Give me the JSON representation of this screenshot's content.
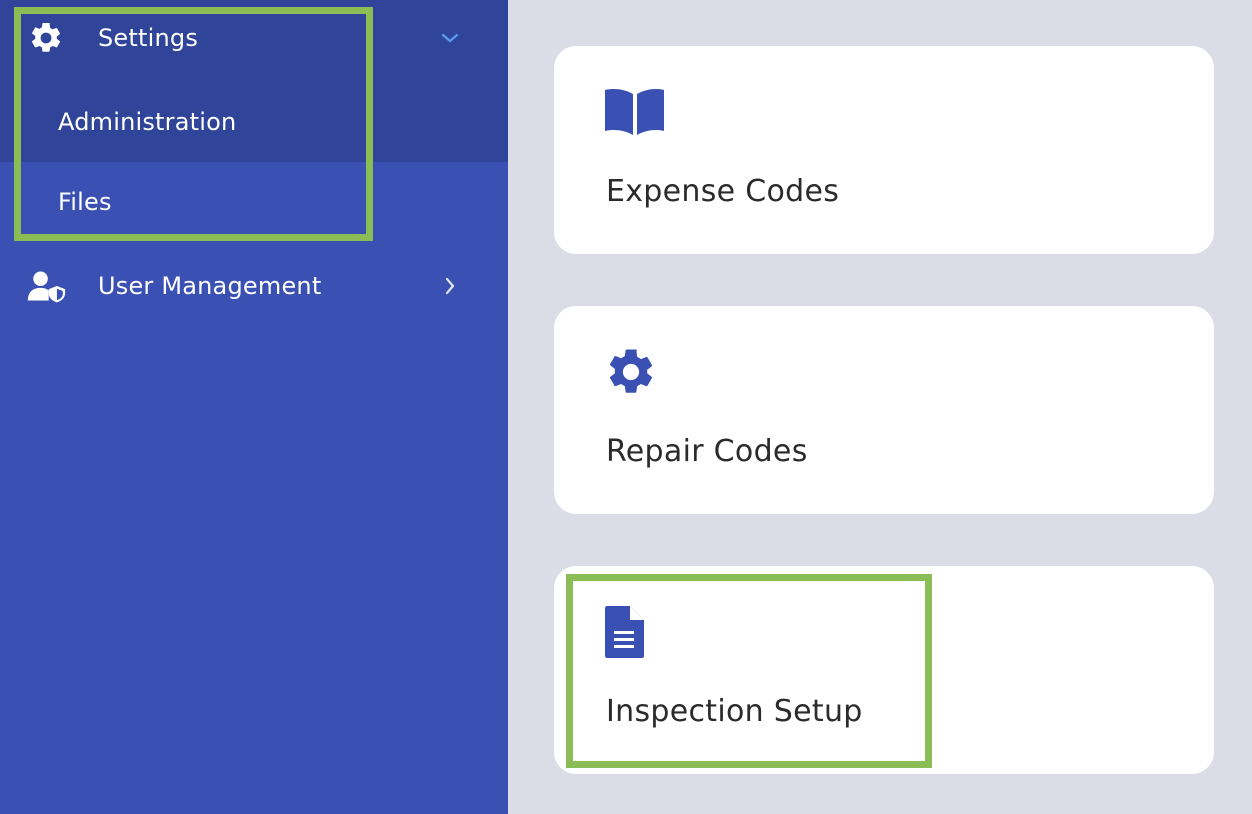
{
  "sidebar": {
    "settings": {
      "label": "Settings",
      "icon": "gear-icon",
      "chevron": "chevron-down-icon"
    },
    "submenu": [
      {
        "label": "Administration"
      },
      {
        "label": "Files"
      }
    ],
    "user_management": {
      "label": "User Management",
      "icon": "user-shield-icon",
      "chevron": "chevron-right-icon"
    }
  },
  "cards": [
    {
      "label": "Expense Codes",
      "icon": "book-icon"
    },
    {
      "label": "Repair Codes",
      "icon": "gear-icon"
    },
    {
      "label": "Inspection Setup",
      "icon": "document-icon"
    }
  ],
  "colors": {
    "sidebar_bg": "#3a50b3",
    "sidebar_group_bg": "#30449a",
    "content_bg": "#dcdce6",
    "accent_icon": "#3a50b3",
    "highlight": "#8bbd57",
    "chevron_down": "#5a9cf0"
  }
}
